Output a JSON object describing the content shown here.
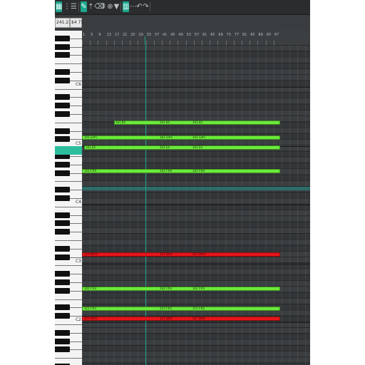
{
  "toolbar": {
    "icons": [
      "grid-icon",
      "snap-icon",
      "list-icon",
      "pencil-icon",
      "select-icon",
      "erase-icon",
      "split-icon",
      "mute-icon",
      "filter-icon",
      "glue-icon",
      "velocity-icon",
      "undo-icon",
      "redo-icon",
      "zoom-icon",
      "scroll-icon",
      "tool-icon"
    ]
  },
  "info": {
    "position": "241.2.00",
    "value": "$4 71"
  },
  "ruler": {
    "labels": [
      "1",
      "5",
      "9",
      "13",
      "17",
      "21",
      "25",
      "29",
      "33",
      "37",
      "41",
      "45",
      "49",
      "53",
      "57",
      "61",
      "65",
      "69",
      "73",
      "77",
      "81",
      "85",
      "89",
      "93",
      "97"
    ]
  },
  "piano": {
    "octave_labels": [
      "C6",
      "C5",
      "C4",
      "C3",
      "C2"
    ]
  },
  "notes": [
    {
      "label": "101 B4",
      "color": "green",
      "parts": [
        "101 B5",
        "101 B5",
        "101 B5"
      ]
    },
    {
      "label": "101 G#5",
      "color": "green",
      "parts": [
        "101 G#5",
        "101 G#5",
        "101 G#5"
      ]
    },
    {
      "label": "101 E4",
      "color": "green",
      "parts": [
        "101 E4",
        "101 E4",
        "101 E4"
      ]
    },
    {
      "label": "102 F#4",
      "color": "green",
      "parts": [
        "102 F#4",
        "102 F#4",
        "102 F#4"
      ]
    },
    {
      "label": "127 D#3",
      "color": "red",
      "parts": [
        "127 D#3",
        "127 D#3",
        "127 D#3"
      ]
    },
    {
      "label": "102 F#3",
      "color": "green",
      "parts": [
        "102 F#3",
        "102 F#3",
        "102 F#3"
      ]
    },
    {
      "label": "115 F#2",
      "color": "green",
      "parts": [
        "115 F#2",
        "115 F#2",
        "115 F#2"
      ]
    },
    {
      "label": "127 D#2",
      "color": "red",
      "parts": [
        "127 D#2",
        "127 D#2",
        "127 D#2"
      ]
    }
  ],
  "colors": {
    "accent": "#1ea58d",
    "green": "#6bea3a",
    "red": "#e8151b"
  }
}
